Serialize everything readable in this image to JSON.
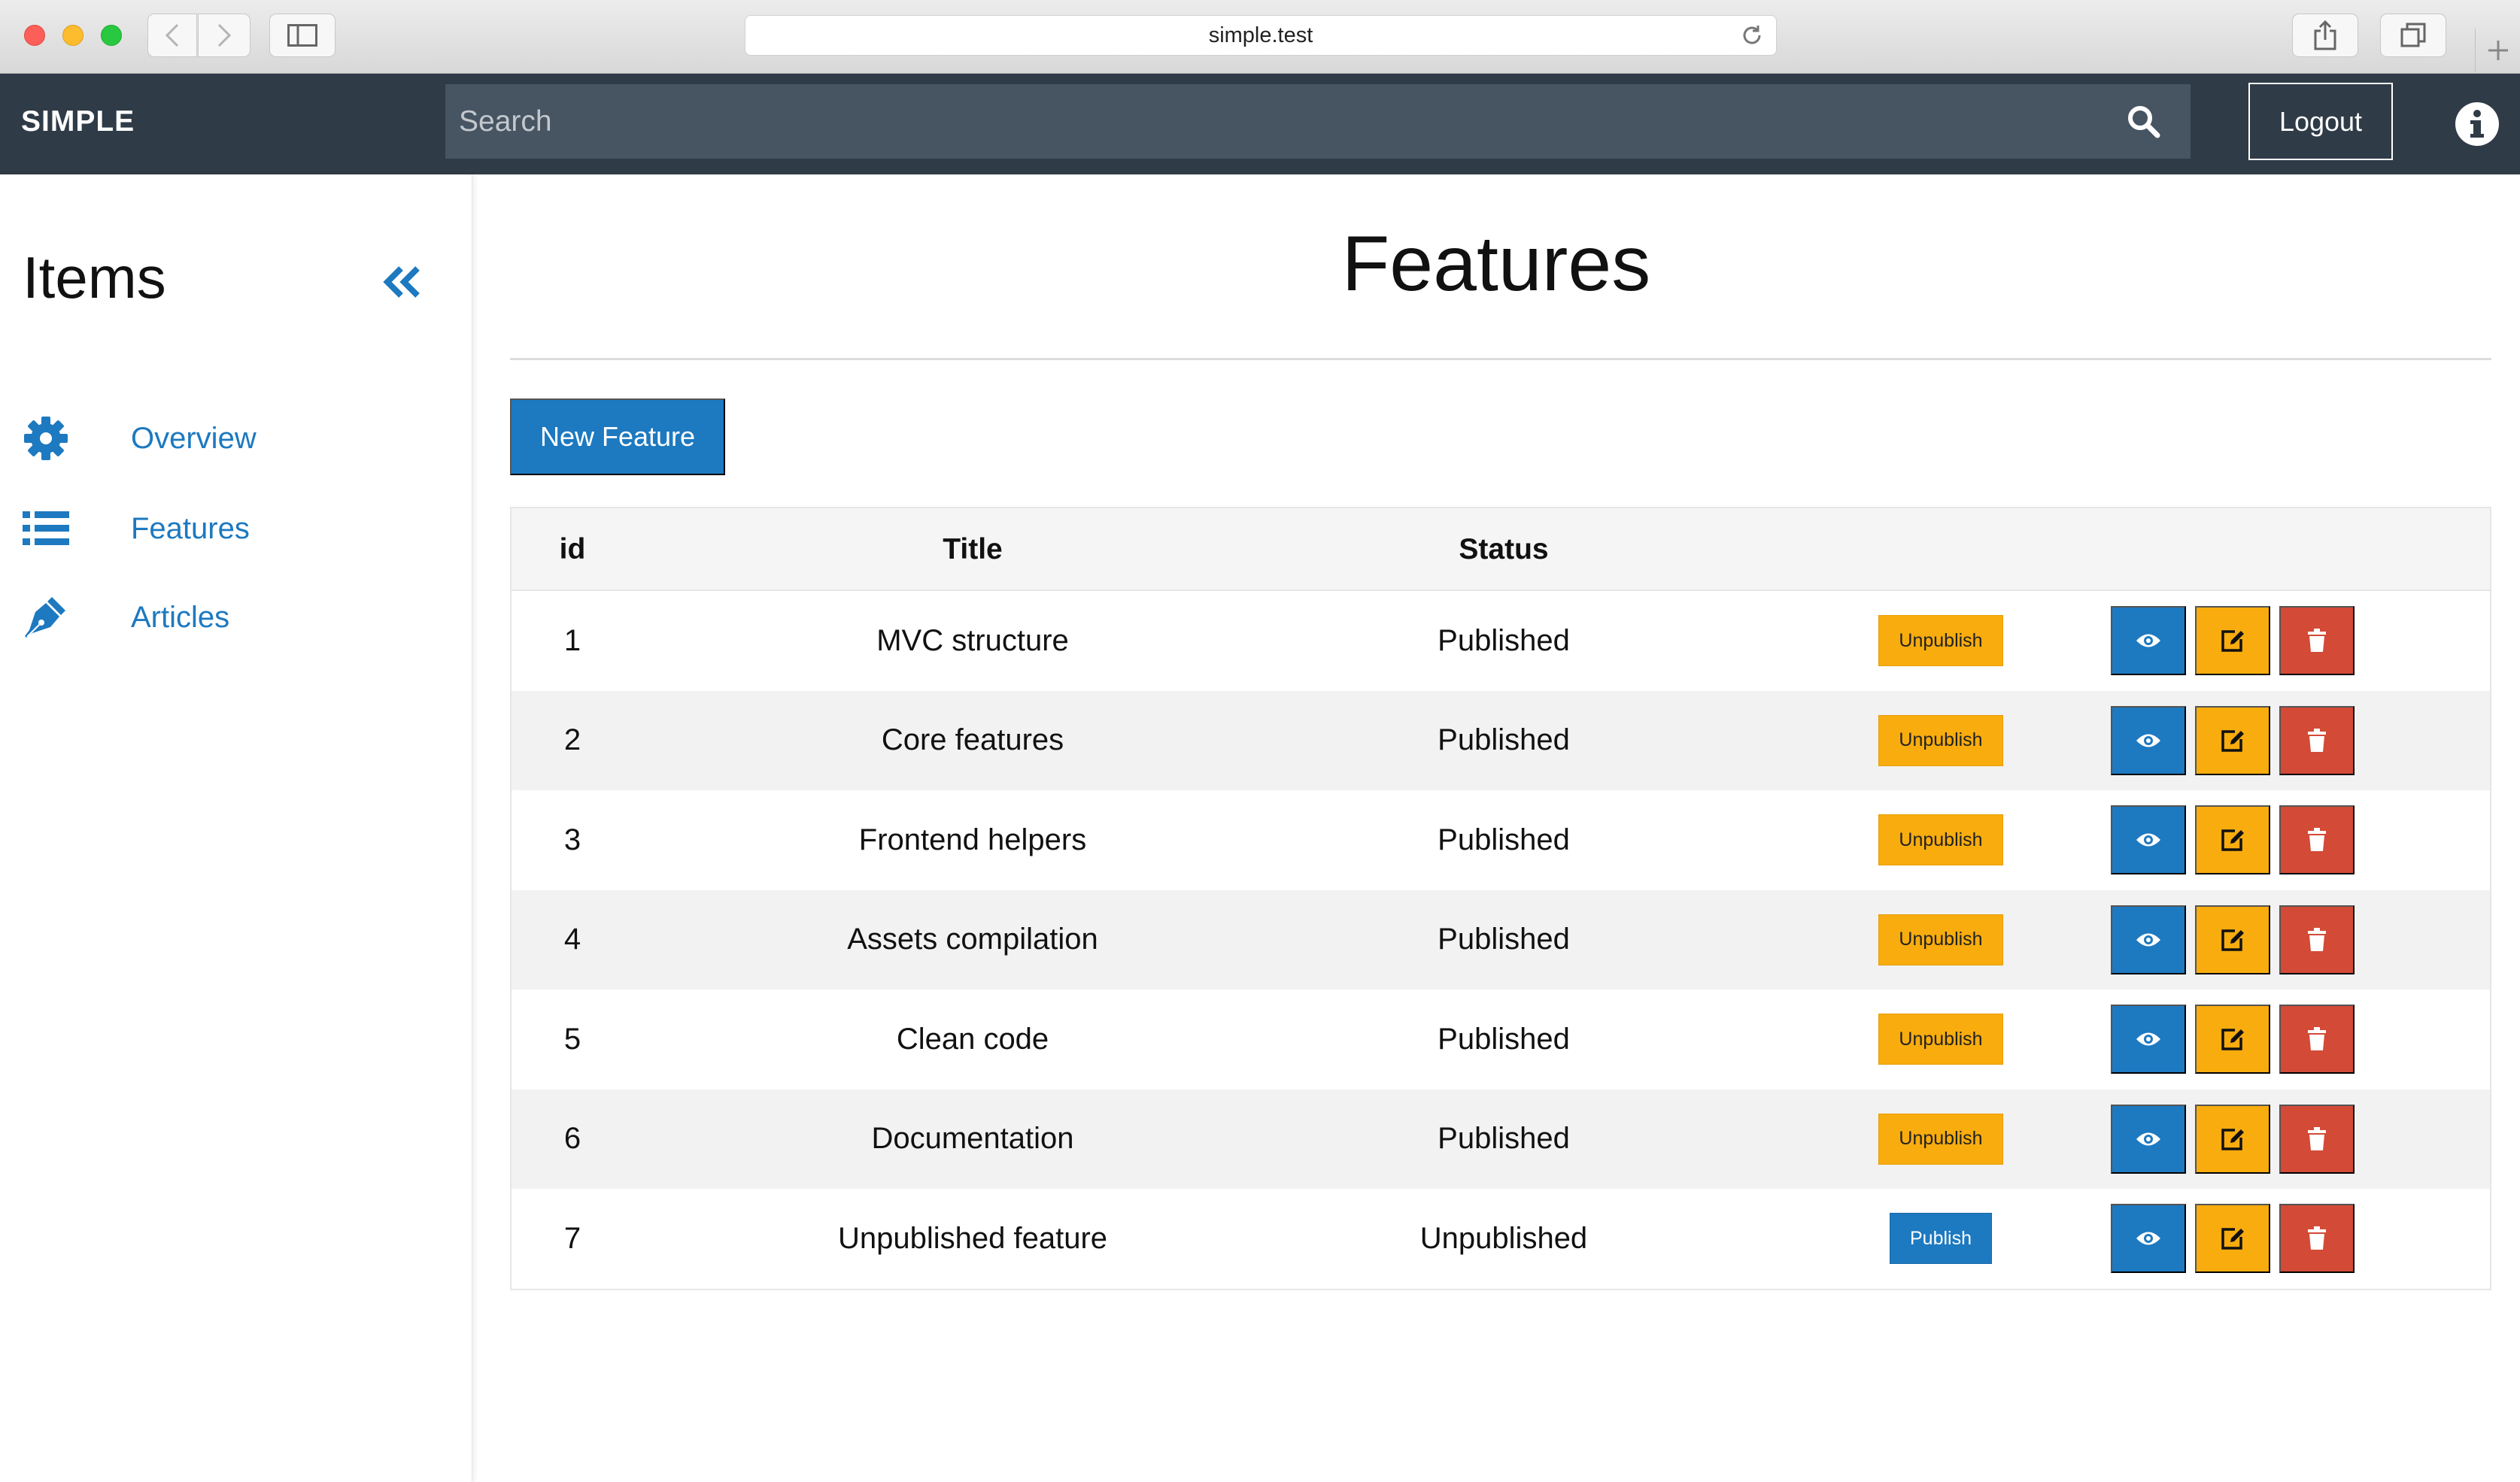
{
  "browser": {
    "url": "simple.test"
  },
  "navbar": {
    "brand": "SIMPLE",
    "search_placeholder": "Search",
    "logout_label": "Logout"
  },
  "sidebar": {
    "title": "Items",
    "items": [
      {
        "label": "Overview",
        "icon": "gear-icon"
      },
      {
        "label": "Features",
        "icon": "list-icon"
      },
      {
        "label": "Articles",
        "icon": "pen-icon"
      }
    ]
  },
  "main": {
    "title": "Features",
    "new_button": "New Feature",
    "table": {
      "headers": [
        "id",
        "Title",
        "Status"
      ],
      "rows": [
        {
          "id": "1",
          "title": "MVC structure",
          "status": "Published",
          "action": "Unpublish"
        },
        {
          "id": "2",
          "title": "Core features",
          "status": "Published",
          "action": "Unpublish"
        },
        {
          "id": "3",
          "title": "Frontend helpers",
          "status": "Published",
          "action": "Unpublish"
        },
        {
          "id": "4",
          "title": "Assets compilation",
          "status": "Published",
          "action": "Unpublish"
        },
        {
          "id": "5",
          "title": "Clean code",
          "status": "Published",
          "action": "Unpublish"
        },
        {
          "id": "6",
          "title": "Documentation",
          "status": "Published",
          "action": "Unpublish"
        },
        {
          "id": "7",
          "title": "Unpublished feature",
          "status": "Unpublished",
          "action": "Publish"
        }
      ]
    }
  },
  "colors": {
    "navbar": "#2f3b47",
    "primary": "#1d79c0",
    "warning": "#f8ac0e",
    "danger": "#d34a36"
  }
}
